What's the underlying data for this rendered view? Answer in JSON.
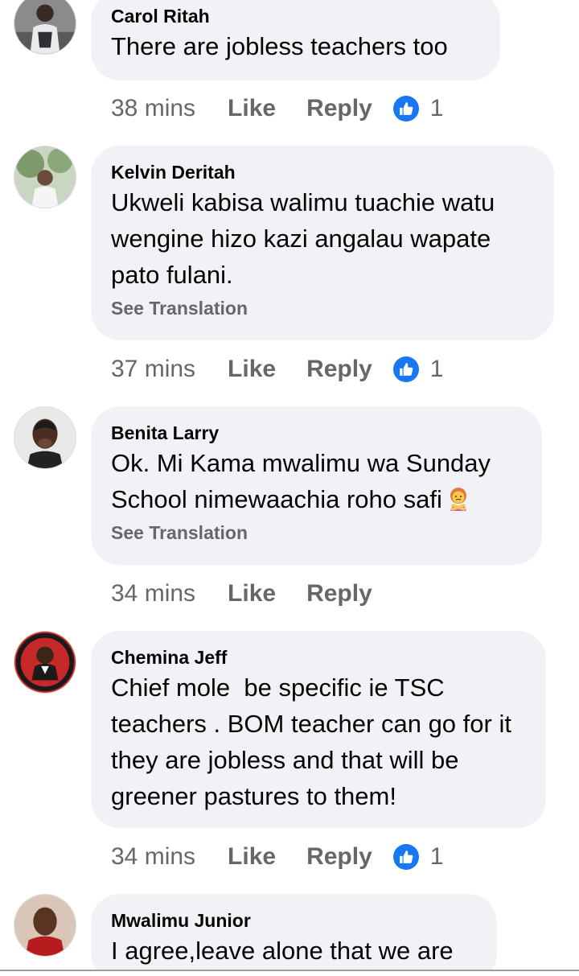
{
  "comments": [
    {
      "author": "Carol Ritah",
      "text": "There are jobless teachers too",
      "time": "38 mins",
      "like_label": "Like",
      "reply_label": "Reply",
      "reaction_count": "1",
      "reaction_icon": "thumbs-up-icon"
    },
    {
      "author": "Kelvin Deritah",
      "text": "Ukweli kabisa walimu tuachie watu wengine hizo kazi angalau wapate pato fulani.",
      "see_translation": "See Translation",
      "time": "37 mins",
      "like_label": "Like",
      "reply_label": "Reply",
      "reaction_count": "1",
      "reaction_icon": "thumbs-up-icon"
    },
    {
      "author": "Benita Larry",
      "text": "Ok. Mi Kama mwalimu wa Sunday School nimewaachia roho safi",
      "emoji": "woman-gesturing-no-emoji",
      "see_translation": "See Translation",
      "time": "34 mins",
      "like_label": "Like",
      "reply_label": "Reply"
    },
    {
      "author": "Chemina Jeff",
      "text": "Chief mole  be specific ie TSC teachers . BOM teacher can go for it they are jobless and that will be greener pastures to them!",
      "time": "34 mins",
      "like_label": "Like",
      "reply_label": "Reply",
      "reaction_count": "1",
      "reaction_icon": "thumbs-up-icon"
    },
    {
      "author": "Mwalimu Junior",
      "text": "I agree,leave alone that we are"
    }
  ],
  "colors": {
    "bubble": "#f0f2f5",
    "secondary_text": "#65676b",
    "like_blue": "#1877f2"
  }
}
